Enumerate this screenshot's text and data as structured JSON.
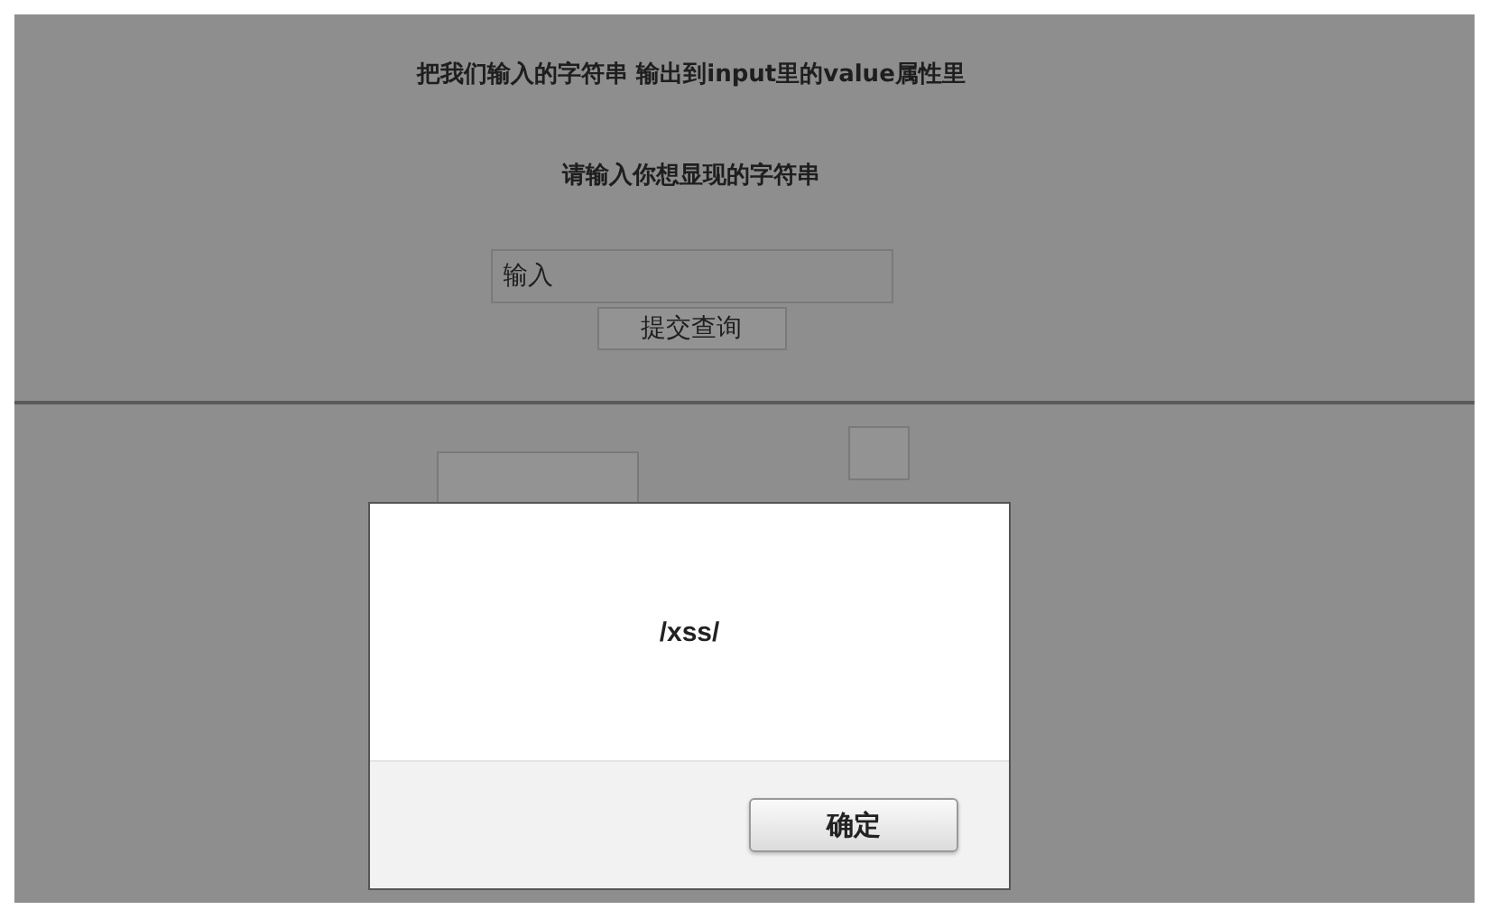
{
  "page": {
    "heading": "把我们输入的字符串 输出到input里的value属性里",
    "prompt": "请输入你想显现的字符串",
    "input": {
      "placeholder": "输入"
    },
    "submit_button": "提交查询"
  },
  "alert": {
    "message": "/xss/",
    "ok_button": "确定"
  }
}
